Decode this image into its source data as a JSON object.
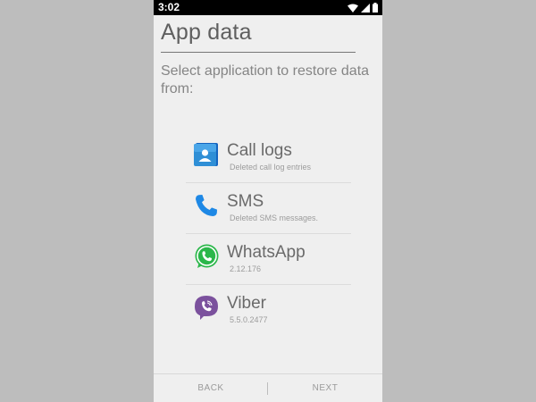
{
  "status_bar": {
    "time": "3:02",
    "icons": [
      "wifi-icon",
      "signal-icon",
      "battery-icon"
    ]
  },
  "screen": {
    "title": "App data",
    "subtitle": "Select application to restore data from:"
  },
  "apps": [
    {
      "name": "Call logs",
      "sub": "Deleted call log entries",
      "icon": "call-logs-icon",
      "color": "#2f8fd6"
    },
    {
      "name": "SMS",
      "sub": "Deleted SMS messages.",
      "icon": "phone-icon",
      "color": "#1e88e5"
    },
    {
      "name": "WhatsApp",
      "sub": "2.12.176",
      "icon": "whatsapp-icon",
      "color": "#2bb74a"
    },
    {
      "name": "Viber",
      "sub": "5.5.0.2477",
      "icon": "viber-icon",
      "color": "#7b519d"
    }
  ],
  "nav": {
    "back_label": "BACK",
    "next_label": "NEXT"
  },
  "colors": {
    "background": "#efefef",
    "outer_background": "#bdbdbd",
    "status_bar": "#000000"
  }
}
